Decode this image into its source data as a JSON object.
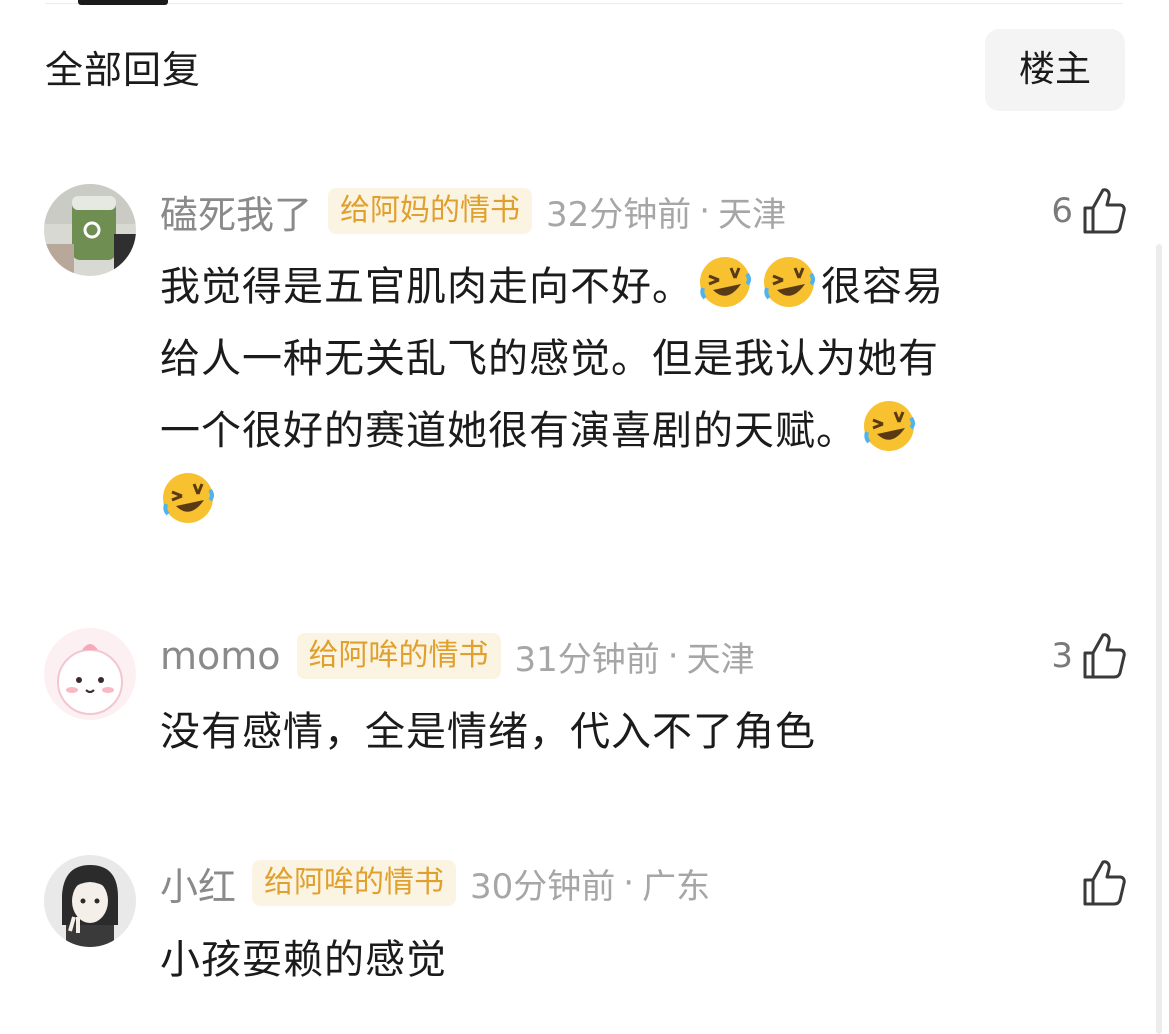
{
  "header": {
    "section_title": "全部回复",
    "op_filter_label": "楼主"
  },
  "comments": [
    {
      "username": "磕死我了",
      "tag": "给阿妈的情书",
      "time": "32分钟前",
      "separator": "·",
      "location": "天津",
      "likes": "6",
      "text_line1": "我觉得是五官肌肉走向不好。",
      "text_line1_tail": "很容易",
      "text_line2": "给人一种无关乱飞的感觉。但是我认为她有",
      "text_line3": "一个很好的赛道她很有演喜剧的天赋。",
      "emoji": "rofl-emoji"
    },
    {
      "username": "momo",
      "tag": "给阿哞的情书",
      "time": "31分钟前",
      "separator": "·",
      "location": "天津",
      "likes": "3",
      "text": "没有感情，全是情绪，代入不了角色"
    },
    {
      "username": "小红",
      "tag": "给阿哞的情书",
      "time": "30分钟前",
      "separator": "·",
      "location": "广东",
      "likes": "",
      "text": "小孩耍赖的感觉"
    }
  ],
  "icons": {
    "like": "thumbs-up-icon",
    "emoji": "rofl-emoji"
  },
  "colors": {
    "tag_text": "#e0a02e",
    "tag_bg": "#fcf4e2",
    "meta_gray": "#a6a6a6",
    "username_gray": "#8a8a8a",
    "body_text": "#1b1b1b"
  }
}
